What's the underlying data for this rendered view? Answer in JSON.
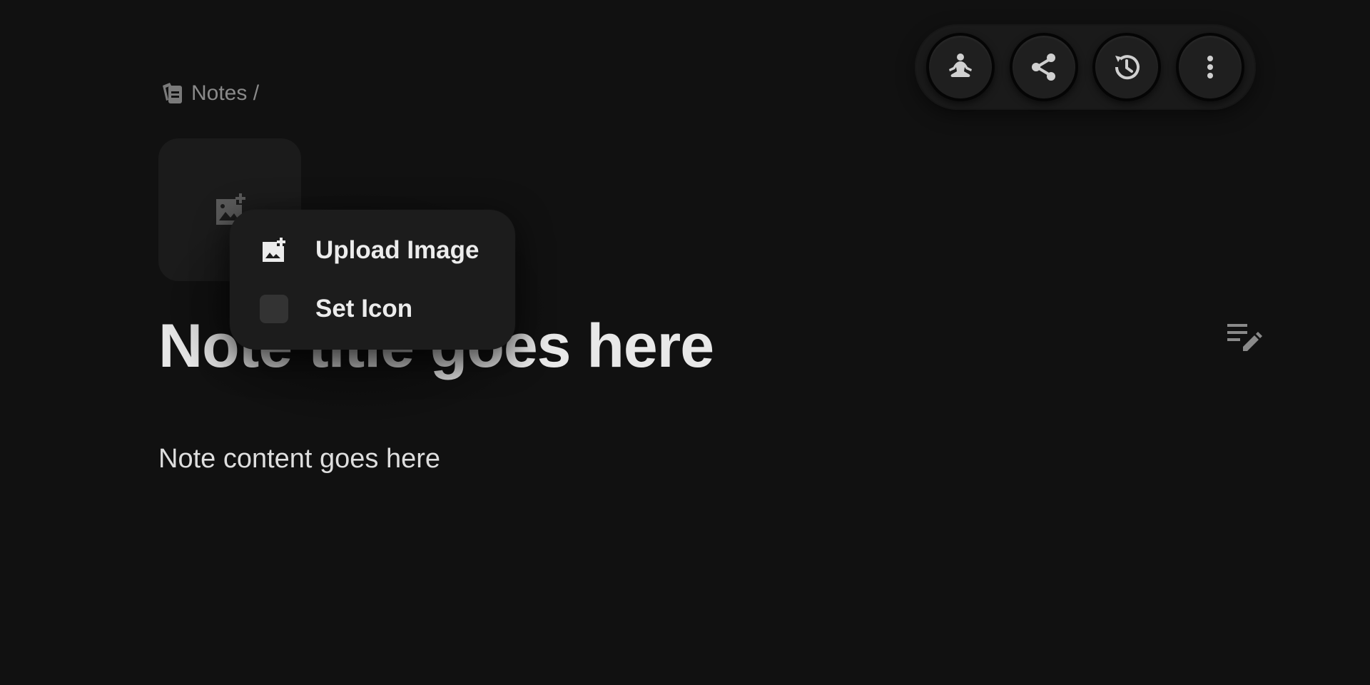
{
  "breadcrumb": {
    "icon": "notes-stack-icon",
    "text": "Notes /"
  },
  "toolbar": {
    "buttons": [
      {
        "icon": "meditation-icon",
        "name": "focus-mode"
      },
      {
        "icon": "share-icon",
        "name": "share"
      },
      {
        "icon": "history-icon",
        "name": "history"
      },
      {
        "icon": "more-vertical-icon",
        "name": "more"
      }
    ]
  },
  "cover": {
    "icon": "add-photo-icon"
  },
  "menu": {
    "upload_image": "Upload Image",
    "set_icon": "Set Icon"
  },
  "note": {
    "title": "Note title goes here",
    "content": "Note content goes here"
  },
  "colors": {
    "background": "#111111",
    "surface": "#1c1c1c",
    "text": "#e8e8e8",
    "muted": "#8a8a8a"
  }
}
